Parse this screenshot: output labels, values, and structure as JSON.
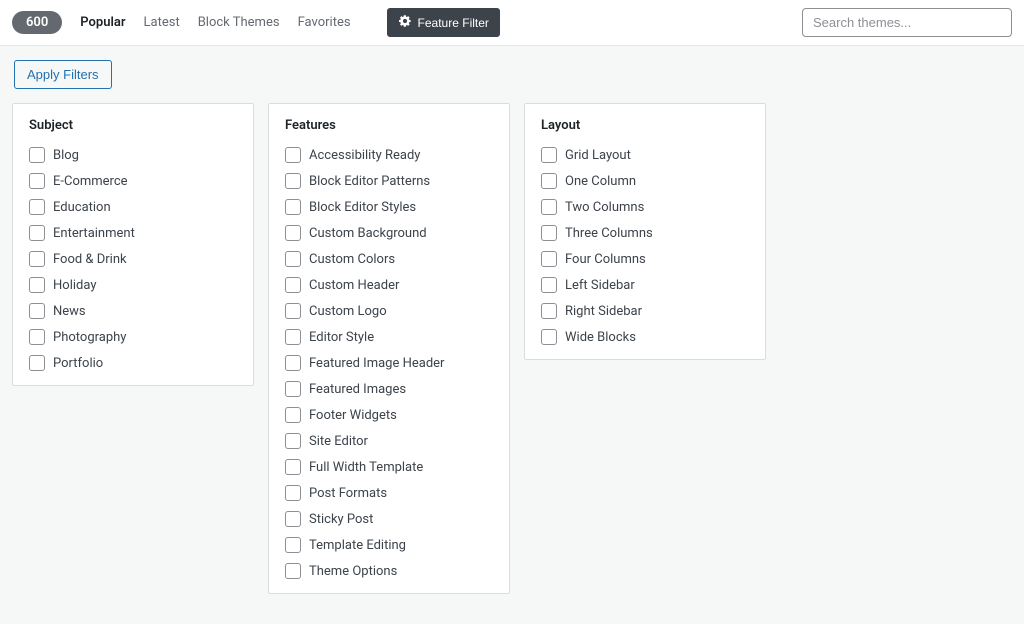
{
  "header": {
    "count": "600",
    "tabs": {
      "popular": "Popular",
      "latest": "Latest",
      "block_themes": "Block Themes",
      "favorites": "Favorites"
    },
    "feature_filter_label": "Feature Filter",
    "search_placeholder": "Search themes..."
  },
  "filters": {
    "apply_label": "Apply Filters",
    "subject": {
      "title": "Subject",
      "items": [
        "Blog",
        "E-Commerce",
        "Education",
        "Entertainment",
        "Food & Drink",
        "Holiday",
        "News",
        "Photography",
        "Portfolio"
      ]
    },
    "features": {
      "title": "Features",
      "items": [
        "Accessibility Ready",
        "Block Editor Patterns",
        "Block Editor Styles",
        "Custom Background",
        "Custom Colors",
        "Custom Header",
        "Custom Logo",
        "Editor Style",
        "Featured Image Header",
        "Featured Images",
        "Footer Widgets",
        "Site Editor",
        "Full Width Template",
        "Post Formats",
        "Sticky Post",
        "Template Editing",
        "Theme Options"
      ]
    },
    "layout": {
      "title": "Layout",
      "items": [
        "Grid Layout",
        "One Column",
        "Two Columns",
        "Three Columns",
        "Four Columns",
        "Left Sidebar",
        "Right Sidebar",
        "Wide Blocks"
      ]
    }
  }
}
